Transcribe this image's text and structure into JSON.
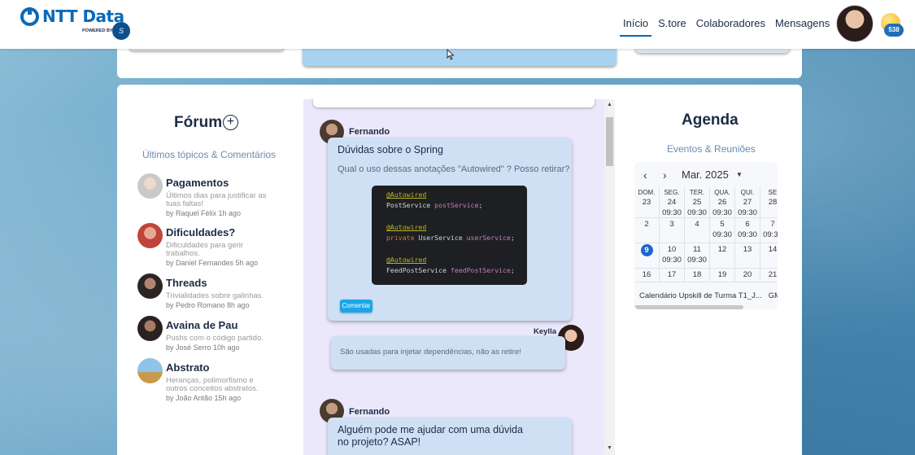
{
  "header": {
    "logo_text": "NTT Data",
    "powered_by": "POWERED BY",
    "powered_badge": "S",
    "nav": [
      {
        "label": "Início",
        "active": true
      },
      {
        "label": "S.tore",
        "active": false
      },
      {
        "label": "Colaboradores",
        "active": false
      },
      {
        "label": "Mensagens",
        "active": false
      }
    ],
    "coins": "538"
  },
  "forum": {
    "title": "Fórum",
    "add_icon": "plus-circle-icon",
    "subtitle": "Últimos tópicos & Comentários",
    "topics": [
      {
        "title": "Pagamentos",
        "desc": "Últimos dias para justificar as tuas faltas!",
        "meta": "by Raquel Félix 1h ago"
      },
      {
        "title": "Dificuldades?",
        "desc": "Dificuldades para gerir trabalhos.",
        "meta": "by Daniel Fernandes 5h ago"
      },
      {
        "title": "Threads",
        "desc": "Trivialidades sobre galinhas.",
        "meta": "by Pedro Romano 8h ago"
      },
      {
        "title": "Avaina de Pau",
        "desc": "Pushs com o código partido.",
        "meta": "by José Serro 10h ago"
      },
      {
        "title": "Abstrato",
        "desc": "Heranças, polimorfismo e outros conceitos abstratos.",
        "meta": "by João Antão 15h ago"
      }
    ]
  },
  "chat": {
    "posts": [
      {
        "author": "Fernando",
        "title": "Dúvidas sobre o Spring",
        "text": "Qual o uso dessas anotações \"Autowired\" ? Posso retirar?",
        "code": [
          {
            "ann": "@Autowired",
            "type": "PostService",
            "var": "postService"
          },
          {
            "ann": "@Autowired",
            "kw": "private",
            "type": "UserService",
            "var": "userService"
          },
          {
            "ann": "@Autowired",
            "type": "FeedPostService",
            "var": "feedPostService"
          }
        ],
        "button": "Comentar"
      }
    ],
    "reply": {
      "author": "Keylla",
      "text": "São usadas para injetar dependências, não as retire!"
    },
    "post2": {
      "author": "Fernando",
      "title": "Alguém pode me ajudar com uma dúvida no projeto? ASAP!"
    }
  },
  "agenda": {
    "title": "Agenda",
    "subtitle": "Eventos & Reuniões",
    "month": "Mar. 2025",
    "weekdays": [
      {
        "name": "DOM.",
        "num": "23"
      },
      {
        "name": "SEG.",
        "num": "24"
      },
      {
        "name": "TER.",
        "num": "25"
      },
      {
        "name": "QUA.",
        "num": "26"
      },
      {
        "name": "QUI.",
        "num": "27"
      },
      {
        "name": "SE",
        "num": "28"
      }
    ],
    "time": "09:30",
    "rows": [
      [
        "2",
        "3",
        "4",
        "5",
        "6",
        "7"
      ],
      [
        "9",
        "10",
        "11",
        "12",
        "13",
        "14"
      ],
      [
        "16",
        "17",
        "18",
        "19",
        "20",
        "21"
      ]
    ],
    "footer": "Calendário Upskill de Turma T1_J...",
    "footer_extra": "GM"
  }
}
